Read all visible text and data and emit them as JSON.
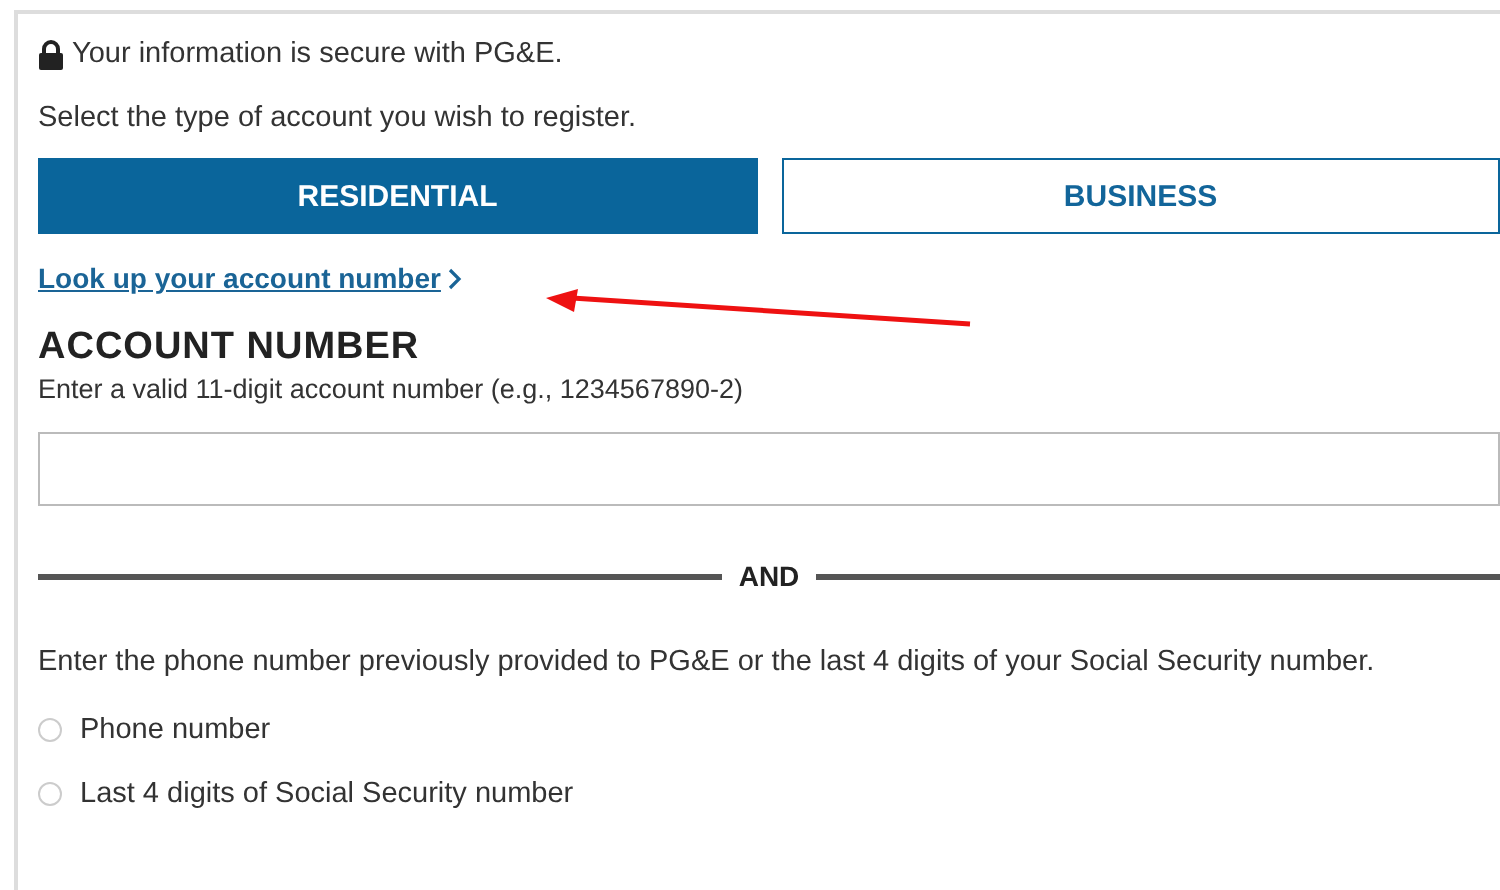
{
  "security_note": "Your information is secure with PG&E.",
  "prompt": "Select the type of account you wish to register.",
  "account_types": [
    {
      "label": "RESIDENTIAL",
      "selected": true
    },
    {
      "label": "BUSINESS",
      "selected": false
    }
  ],
  "lookup_link": "Look up your account number",
  "account_number": {
    "heading": "ACCOUNT NUMBER",
    "hint": "Enter a valid 11-digit account number (e.g., 1234567890-2)"
  },
  "divider": "AND",
  "verify_prompt": "Enter the phone number previously provided to PG&E or the last 4 digits of your Social Security number.",
  "verify_options": [
    {
      "label": "Phone number",
      "selected": false
    },
    {
      "label": "Last 4 digits of Social Security number",
      "selected": false
    }
  ]
}
